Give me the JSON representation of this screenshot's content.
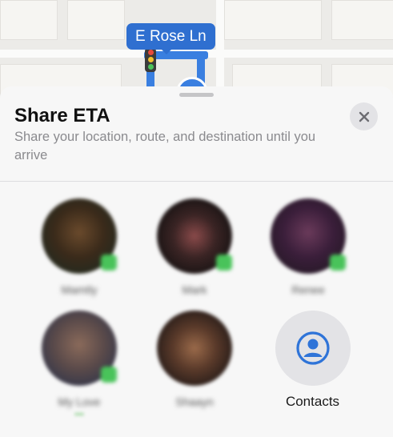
{
  "map": {
    "street_label": "E Rose Ln"
  },
  "sheet": {
    "title": "Share ETA",
    "subtitle": "Share your location, route, and destination until you arrive",
    "close_icon": "close-icon"
  },
  "contacts": [
    {
      "name": "Mamtly",
      "badge": "messages-icon"
    },
    {
      "name": "Mark",
      "badge": "messages-icon"
    },
    {
      "name": "Renee",
      "badge": "messages-icon"
    },
    {
      "name": "My Love",
      "badge": "messages-icon",
      "sub": "•••"
    },
    {
      "name": "Shaayn",
      "badge": "none"
    }
  ],
  "contacts_button": {
    "label": "Contacts",
    "icon": "person-circle-icon"
  },
  "colors": {
    "accent": "#2f6fd0",
    "route": "#3a7fe0",
    "sheet_bg": "#f7f7f7",
    "badge_green": "#49c35a"
  }
}
